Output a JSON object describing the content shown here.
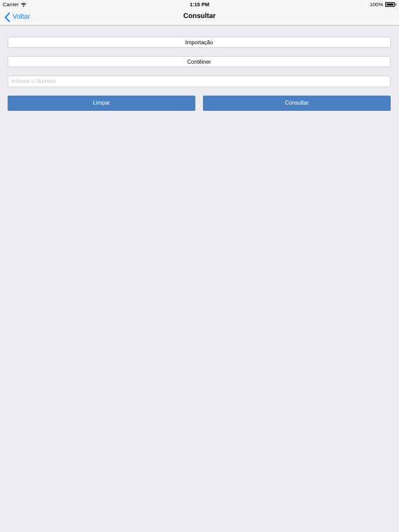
{
  "status_bar": {
    "carrier": "Carrier",
    "time": "1:15 PM",
    "battery": "100%"
  },
  "nav": {
    "back_label": "Voltar",
    "title": "Consultar"
  },
  "form": {
    "type_button": "Importação",
    "category_button": "Contêiner",
    "number_placeholder": "Informe o Número",
    "number_value": "",
    "clear_label": "Limpar",
    "search_label": "Consultar"
  },
  "colors": {
    "accent": "#1a7cf5",
    "button": "#4a7fc1",
    "background": "#ebebf1"
  }
}
